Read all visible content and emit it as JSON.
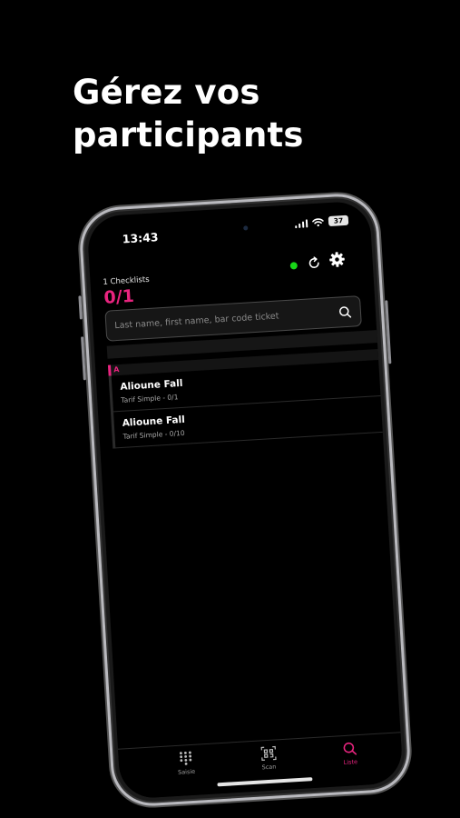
{
  "headline": {
    "line1": "Gérez vos",
    "line2": "participants"
  },
  "status_bar": {
    "time": "13:43",
    "battery": "37"
  },
  "header": {
    "checklists_label": "1 Checklists",
    "count": "0/1"
  },
  "search": {
    "placeholder": "Last name, first name, bar code ticket"
  },
  "list": {
    "section_letter": "A",
    "items": [
      {
        "name": "Alioune Fall",
        "subtitle": "Tarif Simple - 0/1"
      },
      {
        "name": "Alioune Fall",
        "subtitle": "Tarif Simple - 0/10"
      }
    ]
  },
  "tabs": [
    {
      "label": "Saisie",
      "icon": "keypad-icon"
    },
    {
      "label": "Scan",
      "icon": "qr-scan-icon"
    },
    {
      "label": "Liste",
      "icon": "search-icon",
      "active": true
    }
  ],
  "colors": {
    "accent": "#e8247f",
    "online": "#18d618",
    "background": "#000000"
  }
}
